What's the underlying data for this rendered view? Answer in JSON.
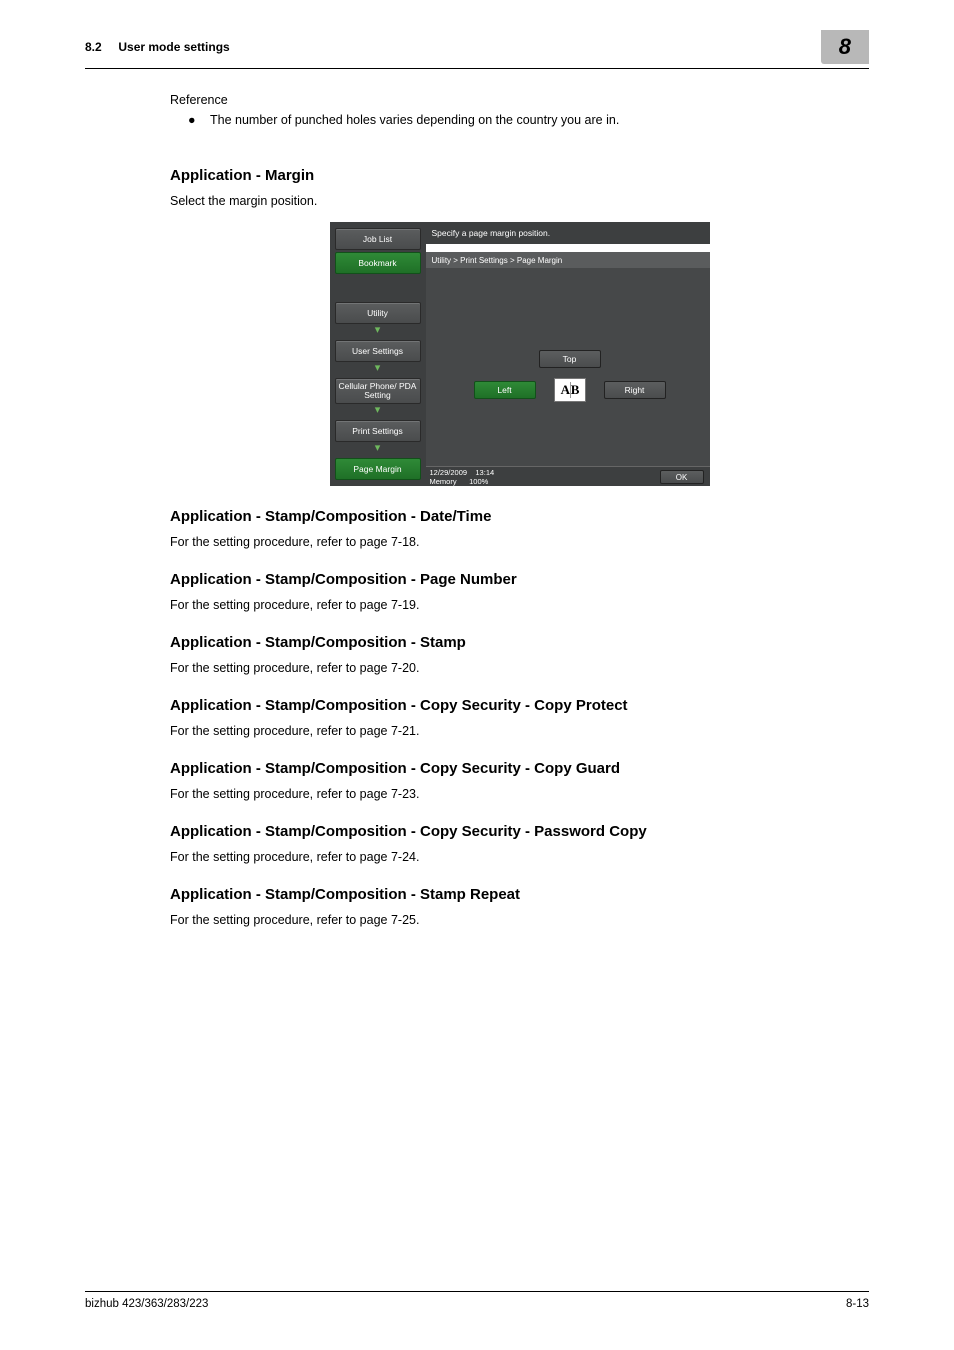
{
  "header": {
    "section_no": "8.2",
    "section_title": "User mode settings",
    "chapter_no": "8"
  },
  "reference": {
    "label": "Reference",
    "bullet": "The number of punched holes varies depending on the country you are in."
  },
  "sections": {
    "margin": {
      "heading": "Application - Margin",
      "body": "Select the margin position."
    },
    "datetime": {
      "heading": "Application - Stamp/Composition - Date/Time",
      "body": "For the setting procedure, refer to page 7-18."
    },
    "pagenum": {
      "heading": "Application - Stamp/Composition - Page Number",
      "body": "For the setting procedure, refer to page 7-19."
    },
    "stamp": {
      "heading": "Application - Stamp/Composition - Stamp",
      "body": "For the setting procedure, refer to page 7-20."
    },
    "copyprotect": {
      "heading": "Application - Stamp/Composition - Copy Security - Copy Protect",
      "body": "For the setting procedure, refer to page 7-21."
    },
    "copyguard": {
      "heading": "Application - Stamp/Composition - Copy Security - Copy Guard",
      "body": "For the setting procedure, refer to page 7-23."
    },
    "passwordcopy": {
      "heading": "Application - Stamp/Composition - Copy Security - Password Copy",
      "body": "For the setting procedure, refer to page 7-24."
    },
    "stamprepeat": {
      "heading": "Application - Stamp/Composition - Stamp Repeat",
      "body": "For the setting procedure, refer to page 7-25."
    }
  },
  "ui": {
    "nav": {
      "joblist": "Job List",
      "bookmark": "Bookmark",
      "utility": "Utility",
      "usersettings": "User Settings",
      "cellular": "Cellular Phone/ PDA Setting",
      "printsettings": "Print Settings",
      "pagemargin": "Page Margin"
    },
    "topbar": "Specify a page margin position.",
    "crumb": "Utility > Print Settings > Page Margin",
    "options": {
      "top": "Top",
      "left": "Left",
      "right": "Right",
      "ab": "A B"
    },
    "status": {
      "date": "12/29/2009",
      "time": "13:14",
      "memory_label": "Memory",
      "memory_value": "100%",
      "ok": "OK"
    }
  },
  "footer": {
    "left": "bizhub 423/363/283/223",
    "right": "8-13"
  }
}
